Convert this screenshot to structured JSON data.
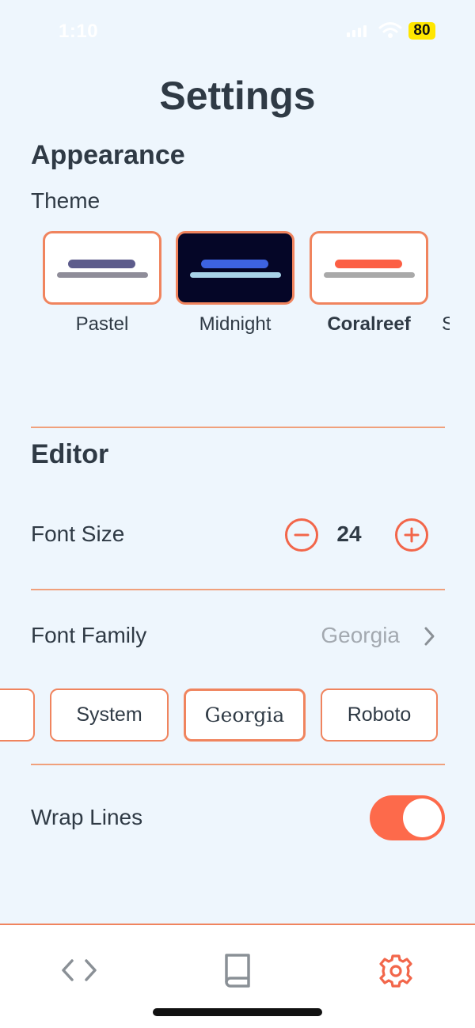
{
  "status_bar": {
    "time": "1:10",
    "battery": "80"
  },
  "page": {
    "title": "Settings"
  },
  "appearance": {
    "section_title": "Appearance",
    "theme_label": "Theme",
    "themes": [
      {
        "name": "Pastel",
        "background": "#ffffff",
        "bar1_color": "#5d5c8c",
        "bar2_color": "#8f8d99",
        "selected": false
      },
      {
        "name": "Midnight",
        "background": "#050627",
        "bar1_color": "#3d63e0",
        "bar2_color": "#a8d2e8",
        "selected": false
      },
      {
        "name": "Coralreef",
        "background": "#ffffff",
        "bar1_color": "#fc5f44",
        "bar2_color": "#a9a9a9",
        "selected": true
      }
    ],
    "theme_overflow_label": "S"
  },
  "editor": {
    "section_title": "Editor",
    "font_size": {
      "label": "Font Size",
      "value": "24",
      "decrement_icon": "minus-circle-icon",
      "increment_icon": "plus-circle-icon"
    },
    "font_family": {
      "label": "Font Family",
      "value": "Georgia",
      "chevron_icon": "chevron-right-icon",
      "options": [
        {
          "label": "System",
          "selected": false
        },
        {
          "label": "Georgia",
          "selected": true
        },
        {
          "label": "Roboto",
          "selected": false
        }
      ]
    },
    "wrap_lines": {
      "label": "Wrap Lines",
      "enabled": true
    }
  },
  "tab_bar": {
    "tabs": [
      {
        "icon": "code-icon",
        "active": false
      },
      {
        "icon": "book-icon",
        "active": false
      },
      {
        "icon": "gear-icon",
        "active": true
      }
    ]
  },
  "colors": {
    "accent": "#f2664a",
    "divider": "#f0a07c",
    "background": "#eef6fd",
    "text": "#2f3a45",
    "muted": "#a3a9b0",
    "inactive_icon": "#8a9096"
  }
}
